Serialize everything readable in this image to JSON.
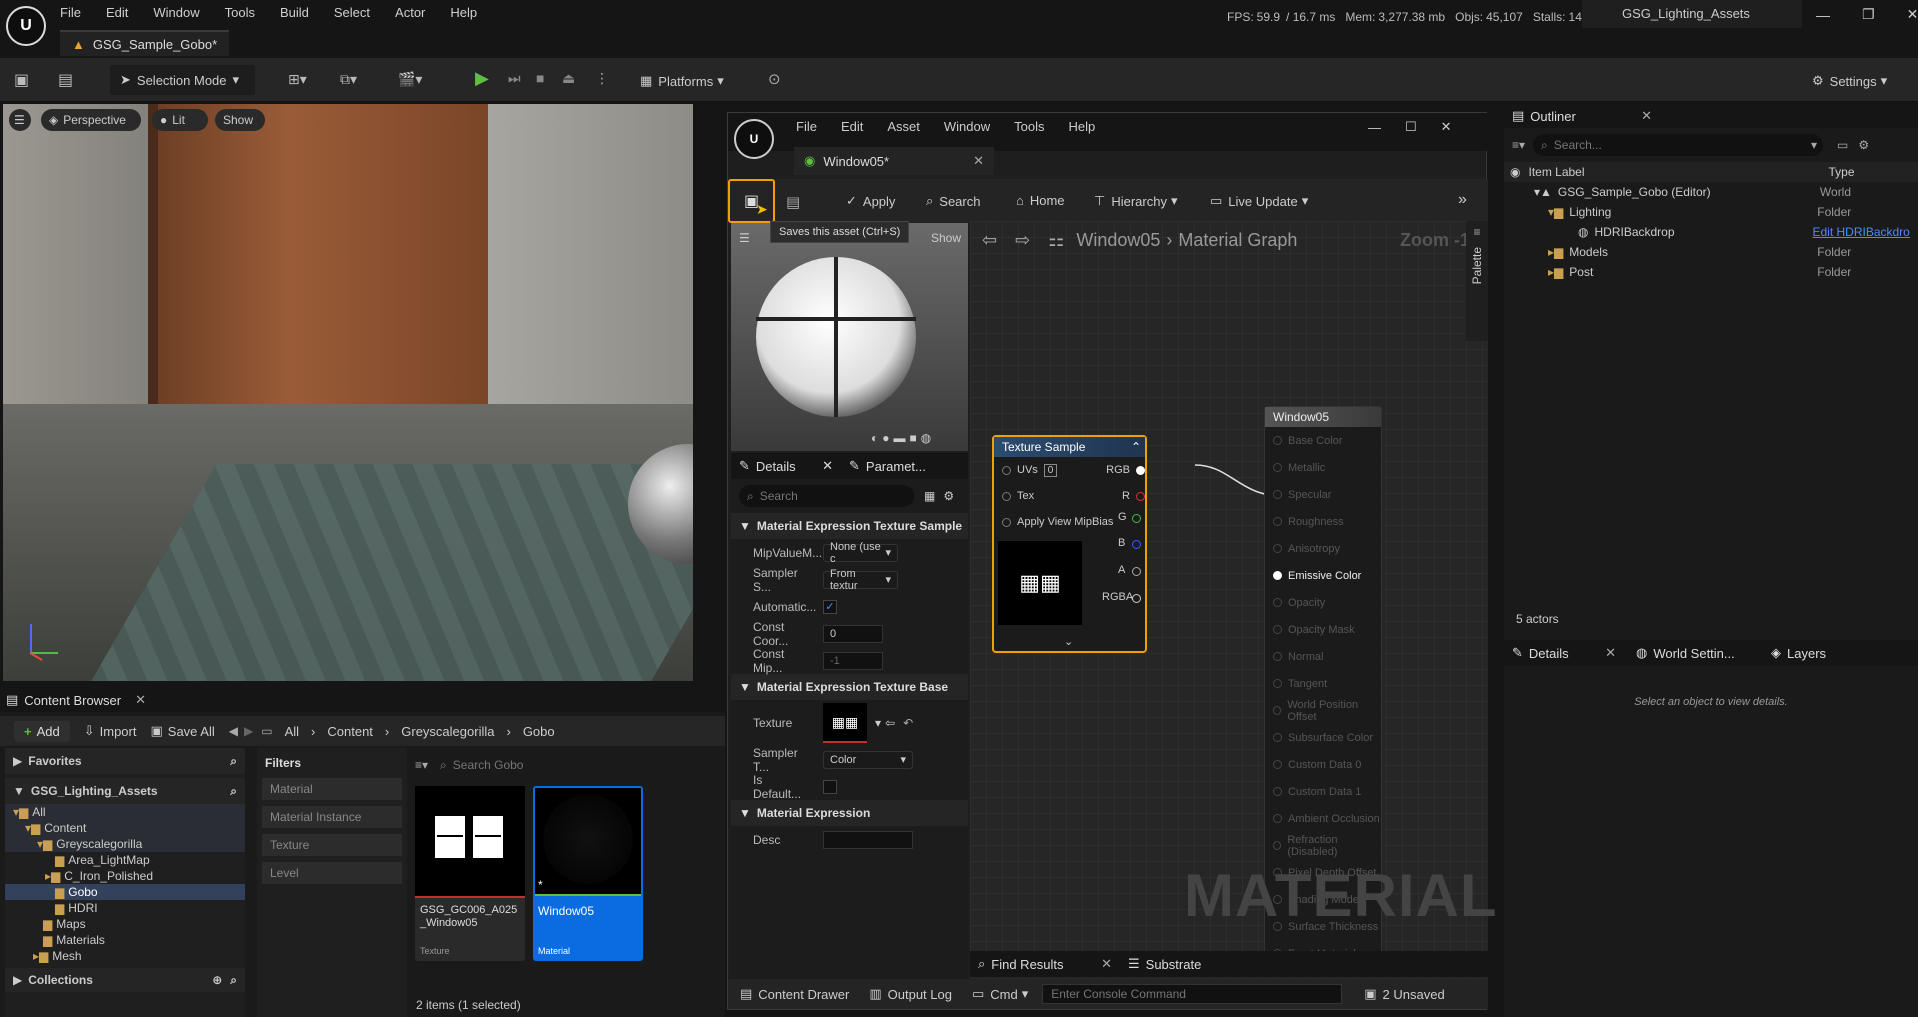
{
  "menu": [
    "File",
    "Edit",
    "Window",
    "Tools",
    "Build",
    "Select",
    "Actor",
    "Help"
  ],
  "doc_tab": "GSG_Sample_Gobo*",
  "stats": {
    "fps_label": "FPS:",
    "fps": "59.9",
    "ms": "/ 16.7 ms",
    "mem_label": "Mem:",
    "mem": "3,277.38 mb",
    "objs_label": "Objs:",
    "objs": "45,107",
    "stalls_label": "Stalls:",
    "stalls": "14"
  },
  "project": "GSG_Lighting_Assets",
  "toolbar": {
    "mode": "Selection Mode",
    "platforms": "Platforms",
    "settings": "Settings"
  },
  "viewport": {
    "perspective": "Perspective",
    "lit": "Lit",
    "show": "Show"
  },
  "content_browser": {
    "tab": "Content Browser",
    "add": "Add",
    "import": "Import",
    "save_all": "Save All",
    "path": [
      "All",
      "Content",
      "Greyscalegorilla",
      "Gobo"
    ],
    "favorites": "Favorites",
    "project": "GSG_Lighting_Assets",
    "tree": [
      "All",
      "Content",
      "Greyscalegorilla",
      "Area_LightMap",
      "C_Iron_Polished",
      "Gobo",
      "HDRI",
      "Maps",
      "Materials",
      "Mesh"
    ],
    "collections": "Collections",
    "filters_title": "Filters",
    "filters": [
      "Material",
      "Material Instance",
      "Texture",
      "Level"
    ],
    "search_placeholder": "Search Gobo",
    "assets": [
      {
        "name": "GSG_GC006_A025_Window05",
        "type": "Texture"
      },
      {
        "name": "Window05",
        "type": "Material"
      }
    ],
    "status": "2 items (1 selected)"
  },
  "material": {
    "menu": [
      "File",
      "Edit",
      "Asset",
      "Window",
      "Tools",
      "Help"
    ],
    "tab": "Window05*",
    "toolbar": {
      "apply": "Apply",
      "search": "Search",
      "home": "Home",
      "hierarchy": "Hierarchy",
      "live_update": "Live Update"
    },
    "tooltip": "Saves this asset (Ctrl+S)",
    "show": "Show",
    "breadcrumb": {
      "asset": "Window05",
      "graph": "Material Graph",
      "zoom": "Zoom -1"
    },
    "palette": "Palette",
    "details_tab": "Details",
    "params_tab": "Paramet...",
    "details_search": "Search",
    "sections": {
      "s1": "Material Expression Texture Sample",
      "mip_label": "MipValueM...",
      "mip_val": "None (use c",
      "sampler_label": "Sampler S...",
      "sampler_val": "From textur",
      "auto_label": "Automatic...",
      "const_coord_label": "Const Coor...",
      "const_coord_val": "0",
      "const_mip_label": "Const Mip...",
      "const_mip_val": "-1",
      "s2": "Material Expression Texture Base",
      "texture_label": "Texture",
      "sampler_t_label": "Sampler T...",
      "sampler_t_val": "Color",
      "is_default_label": "Is Default...",
      "s3": "Material Expression",
      "desc_label": "Desc"
    },
    "tex_node": {
      "title": "Texture Sample",
      "uvs": "UVs",
      "uvs_val": "0",
      "tex": "Tex",
      "mipbias": "Apply View MipBias",
      "outputs": [
        "RGB",
        "R",
        "G",
        "B",
        "A",
        "RGBA"
      ]
    },
    "result_node": {
      "title": "Window05",
      "pins": [
        "Base Color",
        "Metallic",
        "Specular",
        "Roughness",
        "Anisotropy",
        "Emissive Color",
        "Opacity",
        "Opacity Mask",
        "Normal",
        "Tangent",
        "World Position Offset",
        "Subsurface Color",
        "Custom Data 0",
        "Custom Data 1",
        "Ambient Occlusion",
        "Refraction (Disabled)",
        "Pixel Depth Offset",
        "Shading Model",
        "Surface Thickness",
        "Front Material"
      ]
    },
    "watermark": "MATERIAL",
    "bottom_tabs": {
      "find": "Find Results",
      "substrate": "Substrate"
    },
    "status": {
      "drawer": "Content Drawer",
      "log": "Output Log",
      "cmd": "Cmd",
      "console_placeholder": "Enter Console Command",
      "unsaved": "2 Unsaved"
    }
  },
  "outliner": {
    "tab": "Outliner",
    "search_placeholder": "Search...",
    "col_label": "Item Label",
    "col_type": "Type",
    "rows": [
      {
        "label": "GSG_Sample_Gobo (Editor)",
        "type": "World"
      },
      {
        "label": "Lighting",
        "type": "Folder"
      },
      {
        "label": "HDRIBackdrop",
        "type": "Edit HDRIBackdro"
      },
      {
        "label": "Models",
        "type": "Folder"
      },
      {
        "label": "Post",
        "type": "Folder"
      }
    ],
    "count": "5 actors"
  },
  "details": {
    "tab": "Details",
    "world": "World Settin...",
    "layers": "Layers",
    "empty": "Select an object to view details."
  },
  "colors": {
    "accent": "#f0a000",
    "selection": "#0070e0",
    "link": "#4a8cff"
  }
}
